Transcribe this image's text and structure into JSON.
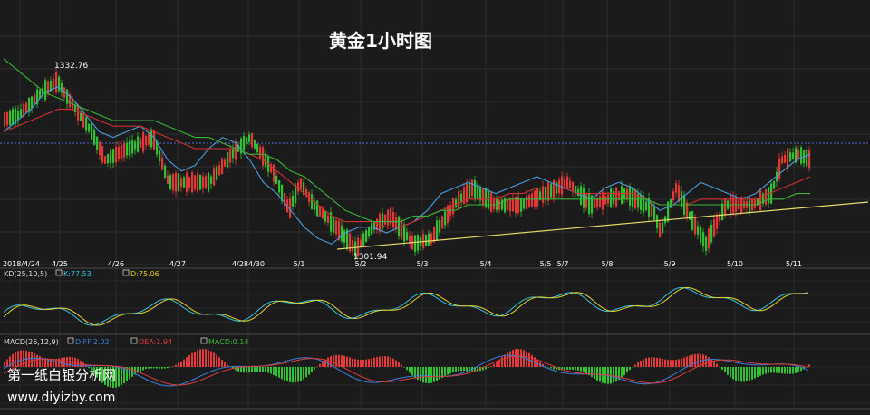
{
  "chart_data": [
    {
      "type": "candlestick",
      "title": "黄金1小时图",
      "x_tick_labels": [
        "2018/4/24",
        "4/25",
        "4/26",
        "4/27",
        "4/284/30",
        "5/1",
        "5/2",
        "5/3",
        "5/4",
        "5/5",
        "5/7",
        "5/8",
        "5/9",
        "5/10",
        "5/11"
      ],
      "annotations": [
        {
          "text": "1332.76",
          "value": 1332.76
        },
        {
          "text": "1301.94",
          "value": 1301.94
        }
      ],
      "y_range": [
        1300,
        1340
      ],
      "current_price_line": 1318.5,
      "grid": true,
      "series": [
        {
          "name": "moving-average-fast",
          "values": [
            1323,
            1325,
            1327,
            1330,
            1331,
            1329,
            1326,
            1323,
            1322,
            1323,
            1324,
            1322,
            1318,
            1316,
            1317,
            1320,
            1322,
            1321,
            1318,
            1314,
            1312,
            1309,
            1306,
            1304,
            1303,
            1305,
            1306,
            1306,
            1305,
            1306,
            1307,
            1309,
            1312,
            1313,
            1314,
            1313,
            1312,
            1313,
            1314,
            1315,
            1314,
            1313,
            1312,
            1311,
            1313,
            1314,
            1313,
            1311,
            1309,
            1310,
            1312,
            1314,
            1313,
            1312,
            1311,
            1312,
            1314,
            1316,
            1318,
            1319
          ]
        },
        {
          "name": "moving-average-mid",
          "values": [
            1323,
            1324,
            1325,
            1326,
            1327,
            1327,
            1326,
            1325,
            1324,
            1324,
            1324,
            1323,
            1322,
            1321,
            1320,
            1320,
            1320,
            1320,
            1319,
            1318,
            1316,
            1314,
            1312,
            1310,
            1308,
            1307,
            1307,
            1307,
            1306,
            1306,
            1307,
            1308,
            1309,
            1310,
            1311,
            1311,
            1311,
            1312,
            1312,
            1313,
            1313,
            1313,
            1312,
            1312,
            1312,
            1312,
            1312,
            1311,
            1310,
            1310,
            1310,
            1311,
            1311,
            1311,
            1311,
            1311,
            1312,
            1313,
            1314,
            1315
          ]
        },
        {
          "name": "moving-average-slow",
          "values": [
            1336,
            1334,
            1332,
            1330,
            1329,
            1328,
            1327,
            1326,
            1325,
            1325,
            1325,
            1325,
            1324,
            1323,
            1322,
            1322,
            1321,
            1320,
            1319,
            1319,
            1318,
            1316,
            1315,
            1313,
            1311,
            1309,
            1308,
            1307,
            1307,
            1307,
            1308,
            1308,
            1309,
            1309,
            1310,
            1310,
            1310,
            1311,
            1311,
            1311,
            1311,
            1311,
            1311,
            1311,
            1311,
            1311,
            1311,
            1311,
            1310,
            1310,
            1310,
            1310,
            1310,
            1310,
            1310,
            1310,
            1311,
            1311,
            1312,
            1312
          ]
        },
        {
          "name": "support-trendline",
          "values": [
            1302,
            1310.5
          ]
        }
      ]
    },
    {
      "type": "line",
      "title": "KD(25,10,5)",
      "series": [
        {
          "name": "K:77.53",
          "color": "#35c1dd"
        },
        {
          "name": "D:75.06",
          "color": "#e6d22a"
        }
      ]
    },
    {
      "type": "bar",
      "title": "MACD(26,12,9)",
      "series": [
        {
          "name": "DIFF:2.02",
          "color": "#3a7fe0"
        },
        {
          "name": "DEA:1.94",
          "color": "#e23b3b"
        },
        {
          "name": "MACD:0.14",
          "color": "#39b83a"
        }
      ]
    }
  ],
  "watermark": {
    "line1": "第一纸白银分析网",
    "line2": "www.diyizby.com"
  }
}
